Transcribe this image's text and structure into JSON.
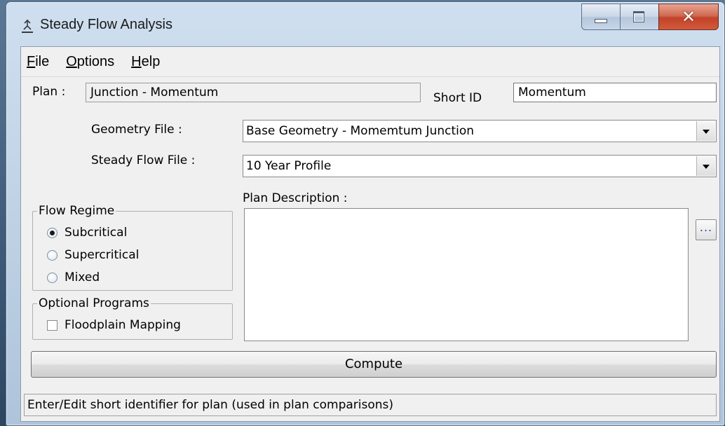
{
  "window": {
    "title": "Steady Flow Analysis"
  },
  "menu": {
    "file": {
      "mnemonic": "F",
      "rest": "ile"
    },
    "options": {
      "mnemonic": "O",
      "rest": "ptions"
    },
    "help": {
      "mnemonic": "H",
      "rest": "elp"
    }
  },
  "plan": {
    "label": "Plan :",
    "value": "Junction - Momentum",
    "short_id_label": "Short ID",
    "short_id_value": "Momentum"
  },
  "geometry": {
    "label": "Geometry File :",
    "value": "Base Geometry - Momemtum Junction"
  },
  "steady_flow": {
    "label": "Steady Flow File :",
    "value": "10 Year Profile"
  },
  "description": {
    "label": "Plan Description :",
    "value": "",
    "browse_label": "..."
  },
  "flow_regime": {
    "title": "Flow Regime",
    "options": [
      "Subcritical",
      "Supercritical",
      "Mixed"
    ],
    "selected": "Subcritical"
  },
  "optional_programs": {
    "title": "Optional Programs",
    "floodplain_mapping_label": "Floodplain Mapping",
    "floodplain_mapping_checked": false
  },
  "compute_label": "Compute",
  "status_text": "Enter/Edit short identifier for plan (used in plan comparisons)"
}
